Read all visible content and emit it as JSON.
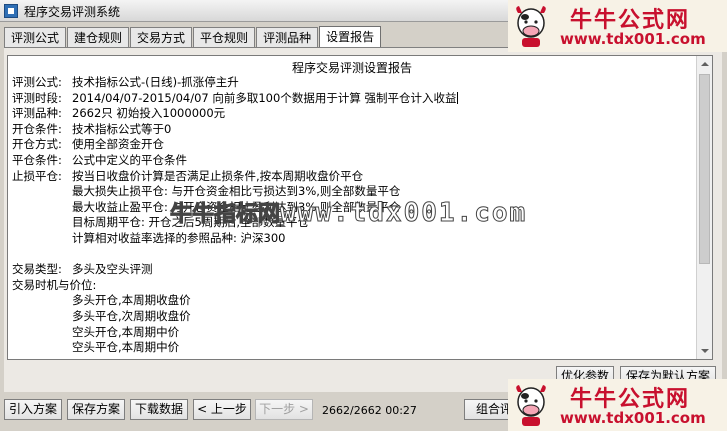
{
  "window": {
    "title": "程序交易评测系统"
  },
  "tabs": [
    {
      "label": "评测公式",
      "active": false
    },
    {
      "label": "建仓规则",
      "active": false
    },
    {
      "label": "交易方式",
      "active": false
    },
    {
      "label": "平仓规则",
      "active": false
    },
    {
      "label": "评测品种",
      "active": false
    },
    {
      "label": "设置报告",
      "active": true
    }
  ],
  "report": {
    "title": "程序交易评测设置报告",
    "lines": [
      {
        "label": "评测公式:",
        "value": "技术指标公式-(日线)-抓涨停主升"
      },
      {
        "label": "评测时段:",
        "value": "2014/04/07-2015/04/07 向前多取100个数据用于计算 强制平仓计入收益"
      },
      {
        "label": "评测品种:",
        "value": "2662只 初始投入1000000元"
      },
      {
        "label": "开仓条件:",
        "value": "技术指标公式等于0"
      },
      {
        "label": "开仓方式:",
        "value": "使用全部资金开仓"
      },
      {
        "label": "平仓条件:",
        "value": "公式中定义的平仓条件"
      },
      {
        "label": "止损平仓:",
        "value": "按当日收盘价计算是否满足止损条件,按本周期收盘价平仓"
      },
      {
        "label": "",
        "value": "最大损失止损平仓: 与开仓资金相比亏损达到3%,则全部数量平仓"
      },
      {
        "label": "",
        "value": "最大收益止盈平仓: 与开仓资金相比盈利达到3%,则全部数量平仓"
      },
      {
        "label": "",
        "value": "目标周期平仓: 开仓之后5周期后,全部数量平仓"
      },
      {
        "label": "",
        "value": "计算相对收益率选择的参照品种: 沪深300"
      },
      {
        "label": "",
        "value": ""
      },
      {
        "label": "交易类型:",
        "value": "多头及空头评测"
      },
      {
        "label": "交易时机与价位:",
        "value": ""
      },
      {
        "label": "",
        "value": "多头开仓,本周期收盘价"
      },
      {
        "label": "",
        "value": "多头平仓,次周期收盘价"
      },
      {
        "label": "",
        "value": "空头开仓,本周期中价"
      },
      {
        "label": "",
        "value": "空头平仓,本周期中价"
      }
    ]
  },
  "buttons": {
    "optimize": "优化参数",
    "save_default": "保存为默认方案",
    "import": "引入方案",
    "save": "保存方案",
    "download": "下载数据",
    "prev": "< 上一步",
    "next": "下一步 >",
    "combo": "组合评"
  },
  "status": {
    "text": "2662/2662 00:27"
  },
  "watermark": {
    "name": "牛牛公式网",
    "url": "www.tdx001.com",
    "overlay_prefix": "牛牛指标网",
    "overlay_url": "www.tdx001.com"
  },
  "icons": {
    "app": "app-icon",
    "mascot": "cow-mascot-icon"
  },
  "colors": {
    "watermark_red": "#c8102e",
    "window_face": "#d4d0c8",
    "report_bg": "#ffffff"
  }
}
